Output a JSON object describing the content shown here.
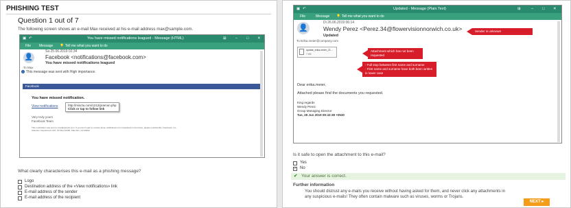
{
  "left": {
    "page_title": "PHISHING TEST",
    "question_title": "Question 1 out of 7",
    "question_desc": "The following screen shows an e-mail Max received at his e-mail address max@sample.com.",
    "email": {
      "window_title": "You have missed notifications leagued - Message (HTML)",
      "ribbon_file": "File",
      "ribbon_message": "Message",
      "ribbon_tell": "Tell me what you want to do",
      "date": "Sa 25.06.2019 02:34",
      "sender": "Facebook <notifications@facebook.com>",
      "subject": "You have missed notifications leagued",
      "to": "To  Max",
      "importance": "This message was sent with High importance.",
      "fb_bar": "Facebook",
      "body_heading": "You have missed notification.",
      "view_link": "View notifications",
      "tooltip_url": "http://misctu.com/1212/pramon.php",
      "tooltip_hint": "Click or tap to follow link",
      "sign_1": "Very truly yours",
      "sign_2": "Facebook Team",
      "footer_1": "This notification was sent to max@sample.com. If you don't want to receive these notifications from Facebook in the future, please unsubscribe. Facebook, Inc.,",
      "footer_2": "Attention: Department 415, PO Box 10005, Palo Alto, CA 94303"
    },
    "prompt": "What clearly characterises this e-mail as a phishing message?",
    "options": [
      "Logo",
      "Destination address of the «View notifications» link",
      "E-mail address of the sender",
      "E-mail address of the recipient"
    ]
  },
  "right": {
    "email": {
      "window_title": "Updated - Message (Plain Text)",
      "ribbon_file": "File",
      "ribbon_message": "Message",
      "ribbon_tell": "Tell me what you want to do",
      "date": "Di 26.06.2019 06:14",
      "sender": "Wendy Perez <Perez.34@flowervisionnorwich.co.uk>",
      "subject": "Updated",
      "to": "To  Erika.meier@company.com",
      "attachment_name": "update_erika.meier_21...",
      "attachment_size": "7 KB",
      "greeting": "Dear erika.meier,",
      "body_line": "Attached please find the documents you requested.",
      "sign_1": "King regards",
      "sign_2": "Wendy Perez",
      "sign_3": "Group Managing Director",
      "sign_4": "Tue, 28 Jun 2019 09:43:38 +0530"
    },
    "callouts": {
      "sender": "Sender is unknown",
      "attachment": "Attachment which has not been requested",
      "name_1": "- Full stop between first name and surname",
      "name_2": "- First name and surname have both been written in lower case"
    },
    "prompt": "Is it safe to open the attachment to this e-mail?",
    "options": [
      "Yes",
      "No"
    ],
    "result": "Your answer is correct.",
    "further_title": "Further information",
    "further_text_1": "You should distrust any e-mails you receive without having asked for them, and never click any attachments in",
    "further_text_2": "any suspicious e-mails! They often contain malware such as viruses, worms or Trojans.",
    "next": "NEXT ▸"
  },
  "colors": {
    "accent_green": "#2a8a6e",
    "callout_red": "#d71d2a",
    "next_orange": "#f59d1a",
    "facebook_blue": "#3b5998",
    "correct_bg": "#e7f3e1"
  }
}
